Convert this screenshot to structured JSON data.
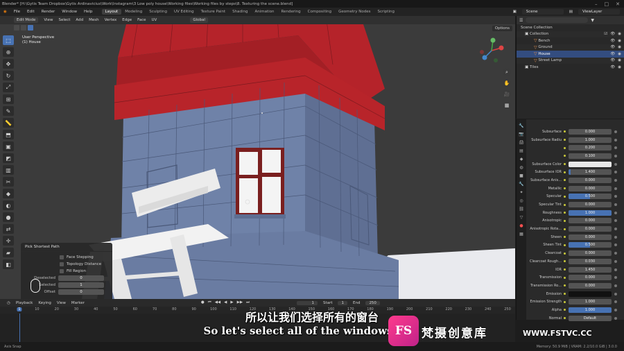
{
  "titlebar": {
    "text": "Blender* [H:\\Gytis Team Dropbox\\Gytis Ardinavicius\\Work\\Instagram\\3 Low poly house\\Working files\\Working files by steps\\8. Texturing the scene.blend]"
  },
  "menu": [
    "File",
    "Edit",
    "Render",
    "Window",
    "Help"
  ],
  "workspaces": [
    "Layout",
    "Modeling",
    "Sculpting",
    "UV Editing",
    "Texture Paint",
    "Shading",
    "Animation",
    "Rendering",
    "Compositing",
    "Geometry Nodes",
    "Scripting"
  ],
  "scene": {
    "name": "Scene",
    "view_layer": "ViewLayer"
  },
  "viewport": {
    "mode": "Edit Mode",
    "menus": [
      "View",
      "Select",
      "Add",
      "Mesh",
      "Vertex",
      "Edge",
      "Face",
      "UV"
    ],
    "transform": "Global",
    "perspective": "User Perspective",
    "object": "(1) House",
    "options": "Options"
  },
  "operator_panel": {
    "title": "Pick Shortest Path",
    "checks": [
      "Face Stepping",
      "Topology Distance",
      "Fill Region"
    ],
    "fields": [
      {
        "label": "Deselected",
        "value": "0"
      },
      {
        "label": "Selected",
        "value": "1"
      },
      {
        "label": "Offset",
        "value": "0"
      }
    ]
  },
  "outliner": {
    "items": [
      {
        "label": "Scene Collection",
        "selected": false
      },
      {
        "label": "Collection",
        "selected": false
      },
      {
        "label": "Bench",
        "selected": false
      },
      {
        "label": "Ground",
        "selected": false
      },
      {
        "label": "House",
        "selected": true
      },
      {
        "label": "Street Lamp",
        "selected": false
      },
      {
        "label": "Tiles",
        "selected": false
      }
    ]
  },
  "properties": {
    "rows": [
      {
        "label": "Subsurface",
        "value": "0.000"
      },
      {
        "label": "Subsurface Radiu",
        "value": "1.000"
      },
      {
        "label": "",
        "value": "0.200"
      },
      {
        "label": "",
        "value": "0.100"
      },
      {
        "label": "Subsurface Color",
        "value": "",
        "style": "white"
      },
      {
        "label": "Subsurface IOR",
        "value": "1.400",
        "fill": 0.05
      },
      {
        "label": "Subsurface Anis...",
        "value": "0.000"
      },
      {
        "label": "Metallic",
        "value": "0.000"
      },
      {
        "label": "Specular",
        "value": "0.500",
        "fill": 0.5
      },
      {
        "label": "Specular Tint",
        "value": "0.000"
      },
      {
        "label": "Roughness",
        "value": "1.000",
        "fill": 1.0
      },
      {
        "label": "Anisotropic",
        "value": "0.000"
      },
      {
        "label": "Anisotropic Rota...",
        "value": "0.000"
      },
      {
        "label": "Sheen",
        "value": "0.000"
      },
      {
        "label": "Sheen Tint",
        "value": "0.500",
        "fill": 0.5
      },
      {
        "label": "Clearcoat",
        "value": "0.000"
      },
      {
        "label": "Clearcoat Rough...",
        "value": "0.030"
      },
      {
        "label": "IOR",
        "value": "1.450"
      },
      {
        "label": "Transmission",
        "value": "0.000"
      },
      {
        "label": "Transmission Ro...",
        "value": "0.000"
      },
      {
        "label": "Emission",
        "value": "",
        "style": "black"
      },
      {
        "label": "Emission Strength",
        "value": "1.000"
      },
      {
        "label": "Alpha",
        "value": "1.000",
        "fill": 1.0
      },
      {
        "label": "Normal",
        "value": "Default"
      }
    ]
  },
  "timeline": {
    "menus": [
      "Playback",
      "Keying",
      "View",
      "Marker"
    ],
    "current_frame": "1",
    "start_label": "Start",
    "start": "1",
    "end_label": "End",
    "end": "250",
    "ruler": [
      "1",
      "10",
      "20",
      "30",
      "40",
      "50",
      "60",
      "70",
      "80",
      "90",
      "100",
      "110",
      "120",
      "130",
      "140",
      "150",
      "160",
      "170",
      "180",
      "190",
      "200",
      "210",
      "220",
      "230",
      "240",
      "250"
    ]
  },
  "statusbar": {
    "left": "Axis Snap",
    "right": "Memory: 50.9 MiB | VRAM: 2.2/10.0 GiB | 3.0.0"
  },
  "subtitles": {
    "cn": "所以让我们选择所有的窗台",
    "en": "So let's select all of the windows"
  },
  "watermark": {
    "logo": "FS",
    "cn": "梵摄创意库",
    "url": "WWW.FSTVC.CC"
  },
  "colors": {
    "accent": "#4772b3",
    "roof": "#b5232a",
    "wall": "#6f82a8",
    "window_frame": "#7a1f1f"
  }
}
